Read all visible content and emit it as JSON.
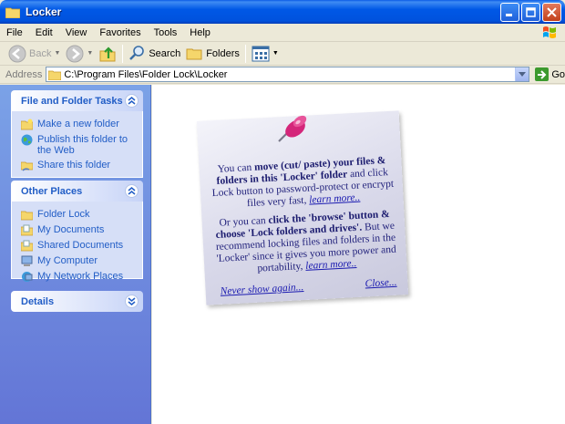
{
  "window": {
    "title": "Locker"
  },
  "menu": [
    "File",
    "Edit",
    "View",
    "Favorites",
    "Tools",
    "Help"
  ],
  "toolbar": {
    "back": "Back",
    "search": "Search",
    "folders": "Folders"
  },
  "address": {
    "label": "Address",
    "value": "C:\\Program Files\\Folder Lock\\Locker",
    "go": "Go"
  },
  "tasks": {
    "title": "File and Folder Tasks",
    "items": [
      {
        "label": "Make a new folder",
        "icon": "new-folder-icon"
      },
      {
        "label": "Publish this folder to the Web",
        "icon": "globe-icon"
      },
      {
        "label": "Share this folder",
        "icon": "share-folder-icon"
      }
    ]
  },
  "places": {
    "title": "Other Places",
    "items": [
      {
        "label": "Folder Lock",
        "icon": "folder-icon"
      },
      {
        "label": "My Documents",
        "icon": "my-documents-icon"
      },
      {
        "label": "Shared Documents",
        "icon": "shared-documents-icon"
      },
      {
        "label": "My Computer",
        "icon": "my-computer-icon"
      },
      {
        "label": "My Network Places",
        "icon": "network-places-icon"
      }
    ]
  },
  "details": {
    "title": "Details"
  },
  "note": {
    "p1_a": "You can ",
    "p1_b": "move (cut/ paste) your files & folders in this 'Locker' folder",
    "p1_c": " and click Lock button to password-protect or encrypt files very fast, ",
    "p1_link": "learn more..",
    "p2_a": "Or you can ",
    "p2_b": "click the 'browse'  button & choose 'Lock folders and drives'.",
    "p2_c": " But we recommend locking files and folders in the 'Locker' since it gives you more power and portability, ",
    "p2_link": "learn more..",
    "never_show": "Never show again...",
    "close": "Close..."
  },
  "colors": {
    "title_blue": "#0054E3",
    "task_link": "#215DC6",
    "note_text": "#1F1F7A"
  }
}
